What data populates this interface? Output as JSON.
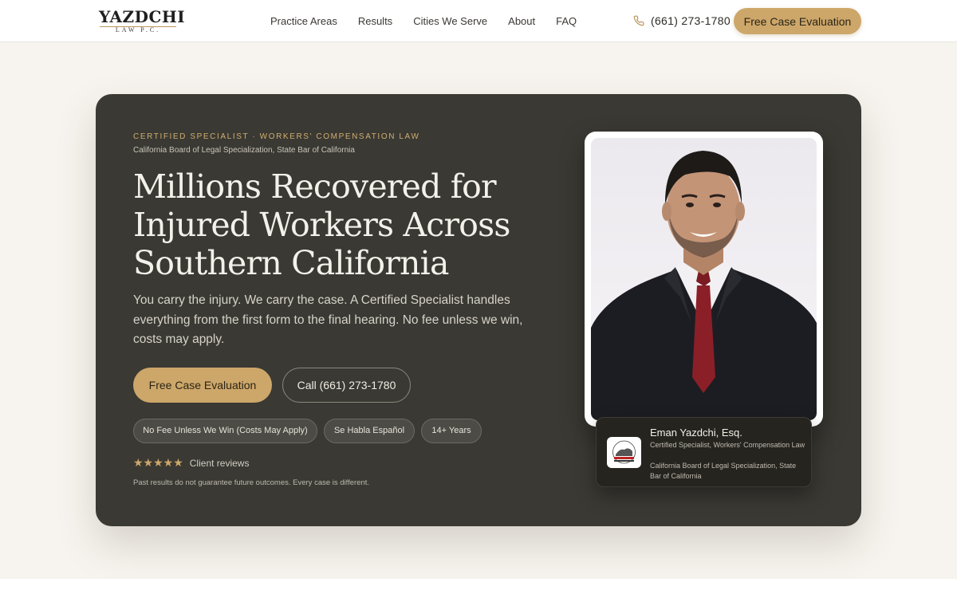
{
  "header": {
    "logo_main": "YAZDCHI",
    "logo_sub": "LAW P.C.",
    "nav": [
      "Practice Areas",
      "Results",
      "Cities We Serve",
      "About",
      "FAQ"
    ],
    "phone": "(661) 273-1780",
    "cta": "Free Case Evaluation"
  },
  "hero": {
    "eyebrow": "CERTIFIED SPECIALIST · WORKERS' COMPENSATION LAW",
    "eyebrow_sub": "California Board of Legal Specialization, State Bar of California",
    "headline_lines": [
      "Millions Recovered for",
      "Injured Workers Across",
      "Southern California"
    ],
    "lede": "You carry the injury. We carry the case. A Certified Specialist handles everything from the first form to the final hearing. No fee unless we win, costs may apply.",
    "primary_cta": "Free Case Evaluation",
    "secondary_cta": "Call (661) 273-1780",
    "pills": [
      "No Fee Unless We Win (Costs May Apply)",
      "Se Habla Español",
      "14+ Years"
    ],
    "stars": "★★★★★",
    "rating_stars": 5,
    "reviews_label": "Client reviews",
    "disclaimer": "Past results do not guarantee future outcomes. Every case is different."
  },
  "attorney_card": {
    "name": "Eman Yazdchi, Esq.",
    "title": "Certified Specialist, Workers' Compensation Law",
    "board": "California Board of Legal Specialization, State Bar of California"
  },
  "icons": {
    "phone": "phone-icon",
    "star": "star-icon",
    "seal": "state-bar-seal-icon"
  },
  "colors": {
    "accent_gold": "#cda76a",
    "hero_bg": "#3a3933",
    "page_bg": "#f7f4ef"
  }
}
